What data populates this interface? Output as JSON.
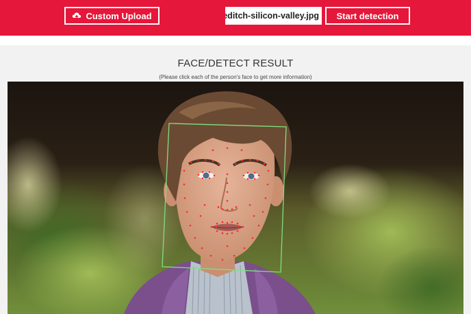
{
  "header": {
    "upload_label": "Custom Upload",
    "filename": "lleditch-silicon-valley.jpg",
    "detect_label": "Start detection",
    "accent_color": "#e5173a"
  },
  "result": {
    "title": "FACE/DETECT RESULT",
    "subtitle": "(Please click each of the person's face to get more information)"
  },
  "photo": {
    "face_box_color": "#7fe07f",
    "landmark_color": "#ff2a2a"
  }
}
